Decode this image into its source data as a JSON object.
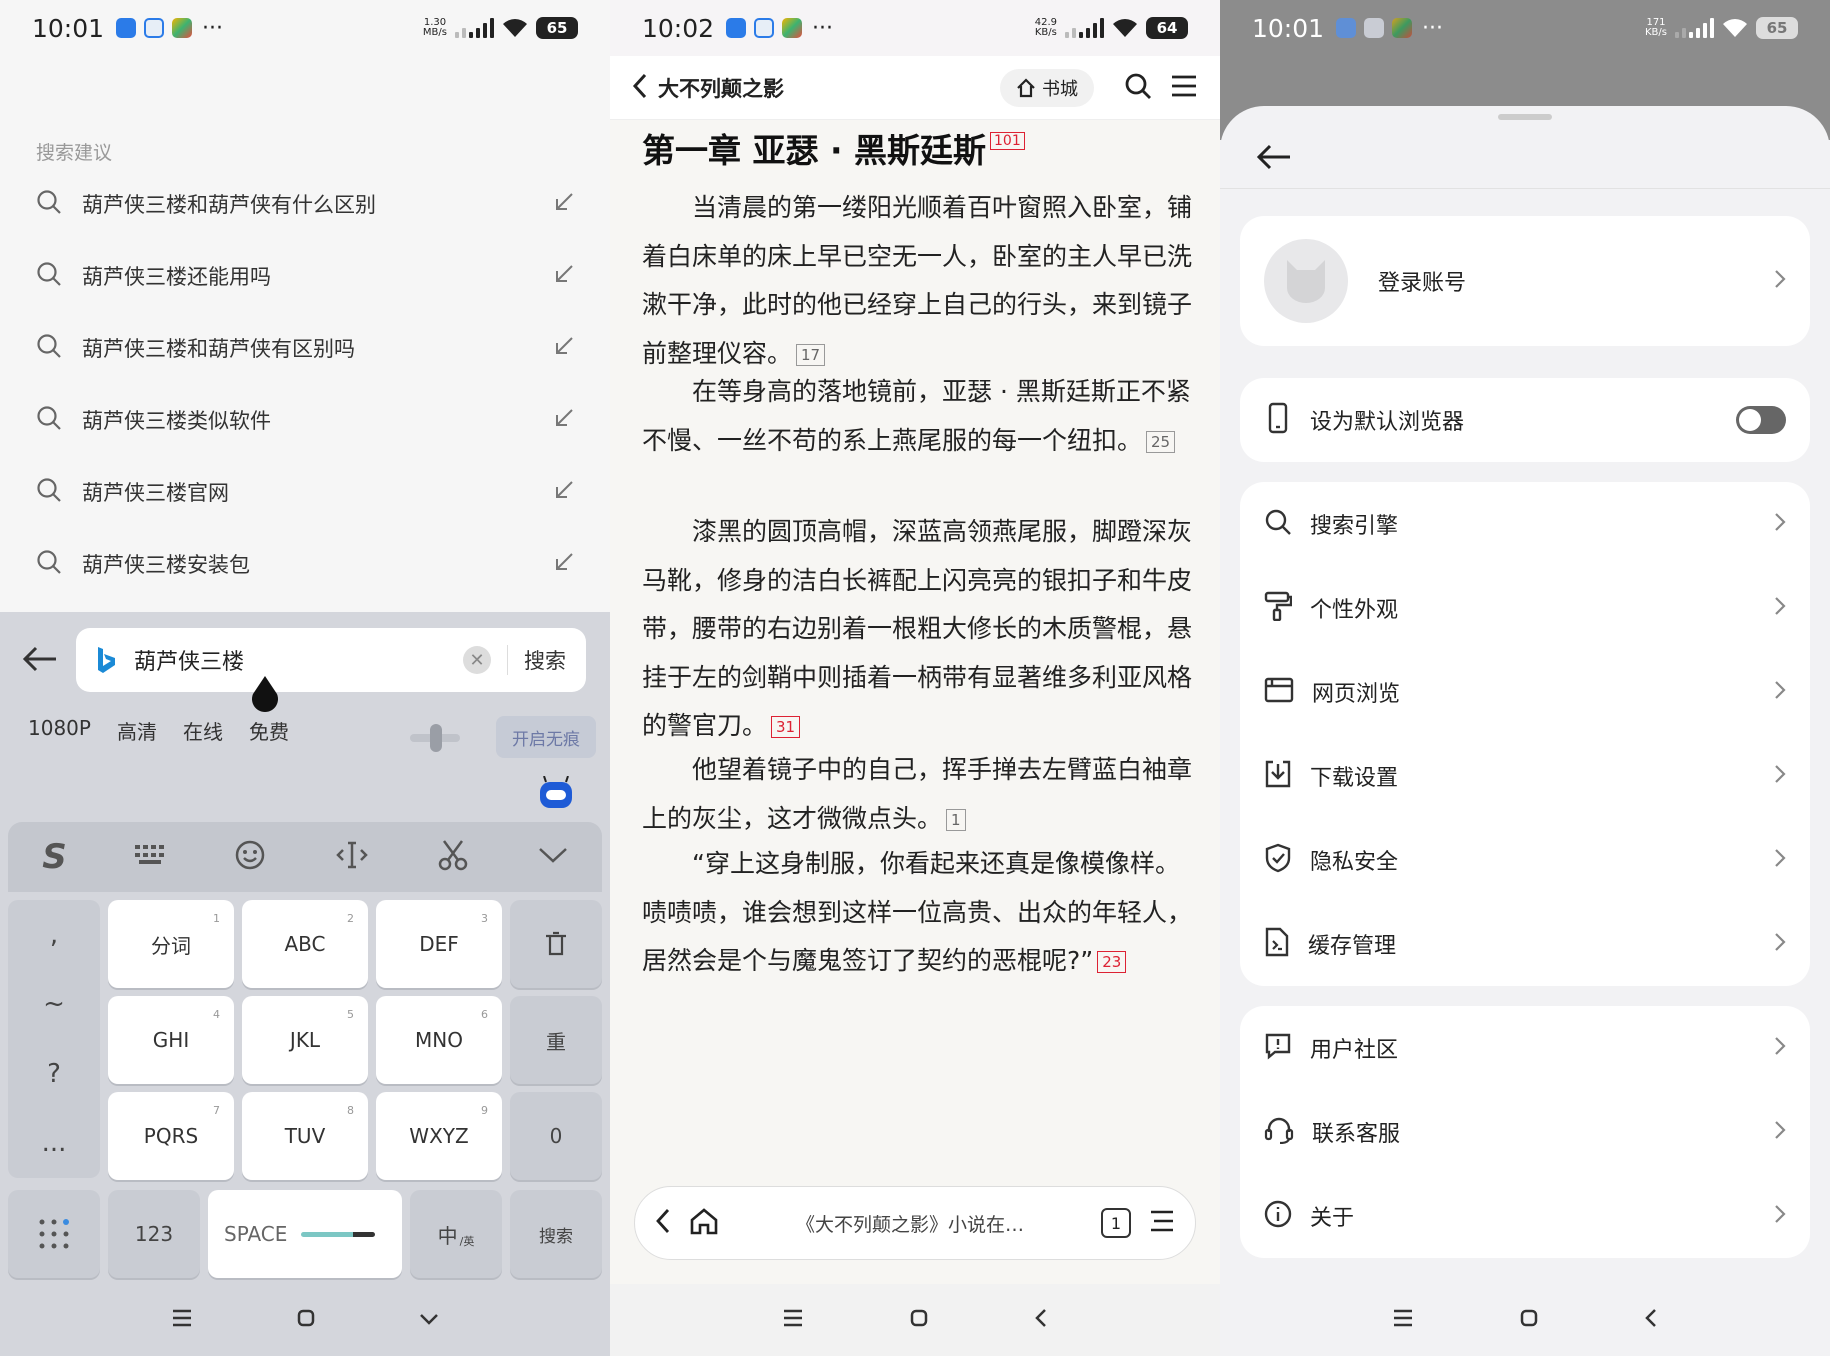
{
  "panel1": {
    "status": {
      "time": "10:01",
      "speed_top": "1.30",
      "speed_bot": "MB/s",
      "battery": "65"
    },
    "suggestion_label": "搜索建议",
    "suggestions": [
      "葫芦侠三楼和葫芦侠有什么区别",
      "葫芦侠三楼还能用吗",
      "葫芦侠三楼和葫芦侠有区别吗",
      "葫芦侠三楼类似软件",
      "葫芦侠三楼官网",
      "葫芦侠三楼安装包"
    ],
    "query": "葫芦侠三楼",
    "search_button": "搜索",
    "chips": [
      "1080P",
      "高清",
      "在线",
      "免费"
    ],
    "incognito": "开启无痕",
    "keys": {
      "k1": "分词",
      "k2": "ABC",
      "k3": "DEF",
      "k4": "GHI",
      "k5": "JKL",
      "k6": "MNO",
      "k7": "PQRS",
      "k8": "TUV",
      "k9": "WXYZ",
      "n1": "1",
      "n2": "2",
      "n3": "3",
      "n4": "4",
      "n5": "5",
      "n6": "6",
      "n7": "7",
      "n8": "8",
      "n9": "9",
      "redo": "重",
      "zero": "0",
      "num": "123",
      "space": "SPACE",
      "lang": "中",
      "lang_sub": "/英",
      "search": "搜索"
    },
    "side_keys": [
      ",",
      "~",
      "?",
      "..."
    ]
  },
  "panel2": {
    "status": {
      "time": "10:02",
      "speed_top": "42.9",
      "speed_bot": "KB/s",
      "battery": "64"
    },
    "book_title": "大不列颠之影",
    "shelf": "书城",
    "chapter": "第一章 亚瑟 · 黑斯廷斯",
    "chapter_badge": "101",
    "paragraphs": [
      {
        "text": "当清晨的第一缕阳光顺着百叶窗照入卧室，铺着白床单的床上早已空无一人，卧室的主人早已洗漱干净，此时的他已经穿上自己的行头，来到镜子前整理仪容。",
        "count": "17"
      },
      {
        "text": "在等身高的落地镜前，亚瑟 · 黑斯廷斯正不紧不慢、一丝不苟的系上燕尾服的每一个纽扣。",
        "count": "25"
      },
      {
        "text": "漆黑的圆顶高帽，深蓝高领燕尾服，脚蹬深灰马靴，修身的洁白长裤配上闪亮亮的银扣子和牛皮带，腰带的右边别着一根粗大修长的木质警棍，悬挂于左的剑鞘中则插着一柄带有显著维多利亚风格的警官刀。",
        "count": "31"
      },
      {
        "text": "他望着镜子中的自己，挥手掸去左臂蓝白袖章上的灰尘，这才微微点头。",
        "count": "1"
      },
      {
        "text": "“穿上这身制服，你看起来还真是像模像样。啧啧啧，谁会想到这样一位高贵、出众的年轻人，居然会是个与魔鬼签订了契约的恶棍呢?”",
        "count": "23"
      }
    ],
    "address": "《大不列颠之影》小说在…",
    "tab_count": "1"
  },
  "panel3": {
    "status": {
      "time": "10:01",
      "speed_top": "171",
      "speed_bot": "KB/s",
      "battery": "65"
    },
    "login": "登录账号",
    "default_browser": "设为默认浏览器",
    "default_browser_on": false,
    "group1": [
      "搜索引擎",
      "个性外观",
      "网页浏览",
      "下载设置",
      "隐私安全",
      "缓存管理"
    ],
    "group2": [
      "用户社区",
      "联系客服",
      "关于"
    ]
  },
  "colors": {
    "accent_red": "#dd2233",
    "bing_blue": "#1b8ad6",
    "toggle_off": "#666666"
  }
}
